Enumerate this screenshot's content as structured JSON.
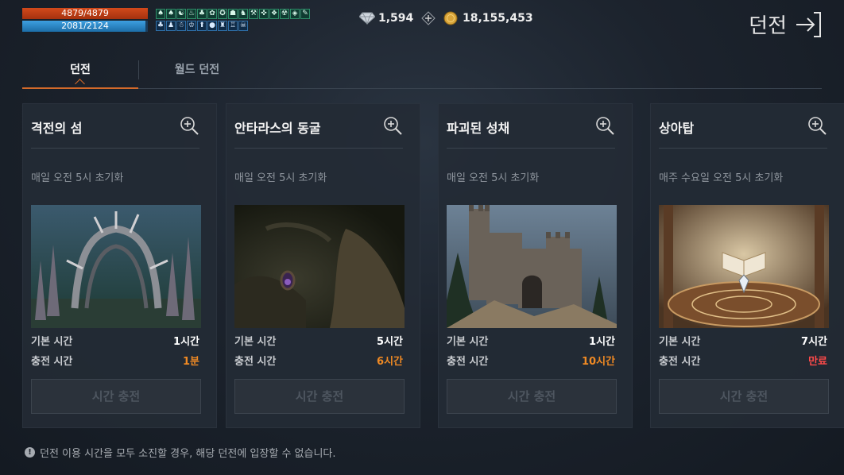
{
  "hud": {
    "hp_text": "4879/4879",
    "hp": 1.0,
    "mp_text": "2081/2124",
    "mp": 0.98,
    "buff_row_1": [
      "♠",
      "♠",
      "☯",
      "♨",
      "♣",
      "✿",
      "✪",
      "☗",
      "♞",
      "⚒",
      "✜",
      "❖",
      "☢",
      "◈",
      "✎"
    ],
    "buff_row_2": [
      "♣",
      "♟",
      "☃",
      "♔",
      "⬆",
      "●",
      "♜",
      "♖",
      "☠"
    ]
  },
  "currency": {
    "gem_amount": "1,594",
    "gold_amount": "18,155,453",
    "gem_icon": "diamond-icon",
    "gold_icon": "gold-coin-icon",
    "plus_icon": "plus-icon"
  },
  "header": {
    "exit_label": "던전",
    "exit_icon": "exit-arrow-icon"
  },
  "tabs": [
    {
      "label": "던전",
      "active": true
    },
    {
      "label": "월드 던전",
      "active": false
    }
  ],
  "labels": {
    "base_time": "기본 시간",
    "charge_time": "충전 시간",
    "charge_button": "시간 충전"
  },
  "dungeons": [
    {
      "title": "격전의 섬",
      "reset": "매일 오전 5시 초기화",
      "base": "1시간",
      "charge": "1분",
      "charge_color": "#f08a24"
    },
    {
      "title": "안타라스의 동굴",
      "reset": "매일 오전 5시 초기화",
      "base": "5시간",
      "charge": "6시간",
      "charge_color": "#f08a24"
    },
    {
      "title": "파괴된 성채",
      "reset": "매일 오전 5시 초기화",
      "base": "1시간",
      "charge": "10시간",
      "charge_color": "#f08a24"
    },
    {
      "title": "상아탑",
      "reset": "매주 수요일 오전 5시 초기화",
      "base": "7시간",
      "charge": "만료",
      "charge_color": "#ff4a4a"
    }
  ],
  "notice": {
    "icon": "warning-icon",
    "text": "던전 이용 시간을 모두 소진할 경우, 해당 던전에 입장할 수 없습니다."
  }
}
